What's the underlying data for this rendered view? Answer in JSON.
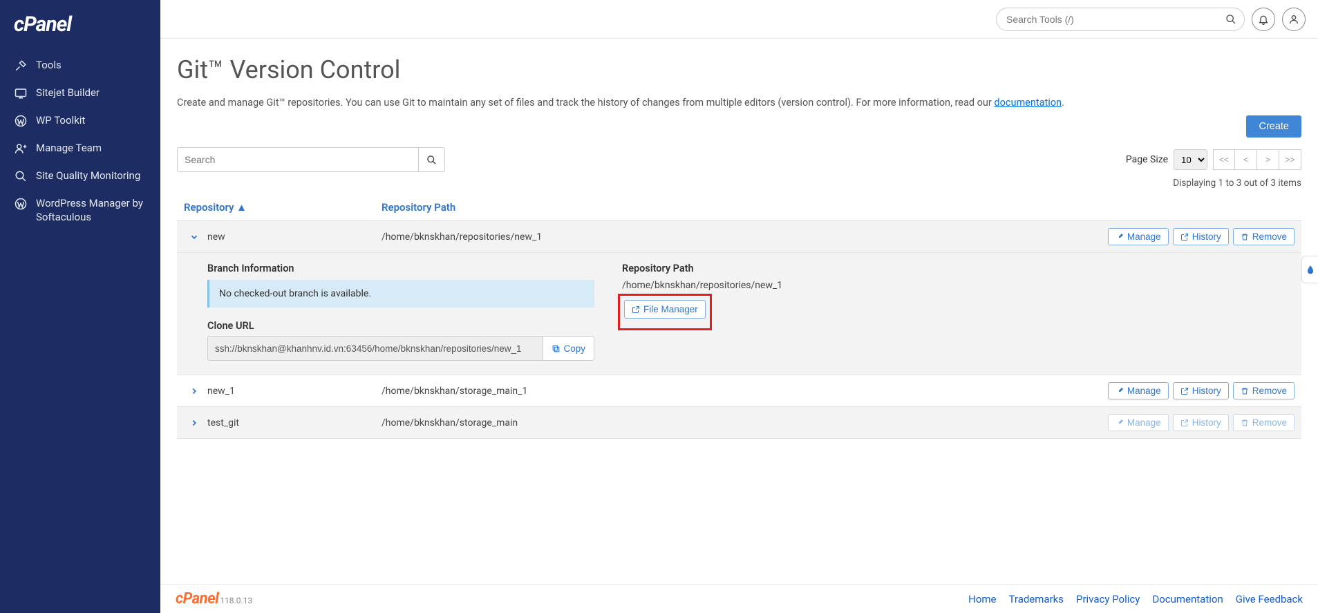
{
  "brand": "cPanel",
  "search_placeholder": "Search Tools (/)",
  "sidebar": {
    "items": [
      {
        "label": "Tools"
      },
      {
        "label": "Sitejet Builder"
      },
      {
        "label": "WP Toolkit"
      },
      {
        "label": "Manage Team"
      },
      {
        "label": "Site Quality Monitoring"
      },
      {
        "label": "WordPress Manager by Softaculous"
      }
    ]
  },
  "page": {
    "title": "Git™ Version Control",
    "desc_prefix": "Create and manage Git™ repositories. You can use Git to maintain any set of files and track the history of changes from multiple editors (version control). For more information, read our ",
    "desc_link": "documentation",
    "desc_suffix": ".",
    "create_label": "Create",
    "tbl_search_placeholder": "Search",
    "page_size_label": "Page Size",
    "page_size_value": "10",
    "pager": {
      "first": "<<",
      "prev": "<",
      "next": ">",
      "last": ">>"
    },
    "display_count": "Displaying 1 to 3 out of 3 items",
    "columns": {
      "repo": "Repository ▲",
      "path": "Repository Path"
    },
    "actions": {
      "manage": "Manage",
      "history": "History",
      "remove": "Remove",
      "copy": "Copy",
      "file_manager": "File Manager"
    }
  },
  "repos": [
    {
      "name": "new",
      "path": "/home/bknskhan/repositories/new_1",
      "expanded": true
    },
    {
      "name": "new_1",
      "path": "/home/bknskhan/storage_main_1",
      "expanded": false
    },
    {
      "name": "test_git",
      "path": "/home/bknskhan/storage_main",
      "expanded": false
    }
  ],
  "detail": {
    "branch_heading": "Branch Information",
    "branch_msg": "No checked-out branch is available.",
    "clone_heading": "Clone URL",
    "clone_url": "ssh://bknskhan@khanhnv.id.vn:63456/home/bknskhan/repositories/new_1",
    "path_heading": "Repository Path",
    "path_value": "/home/bknskhan/repositories/new_1"
  },
  "footer": {
    "version": "118.0.13",
    "links": [
      "Home",
      "Trademarks",
      "Privacy Policy",
      "Documentation",
      "Give Feedback"
    ]
  }
}
